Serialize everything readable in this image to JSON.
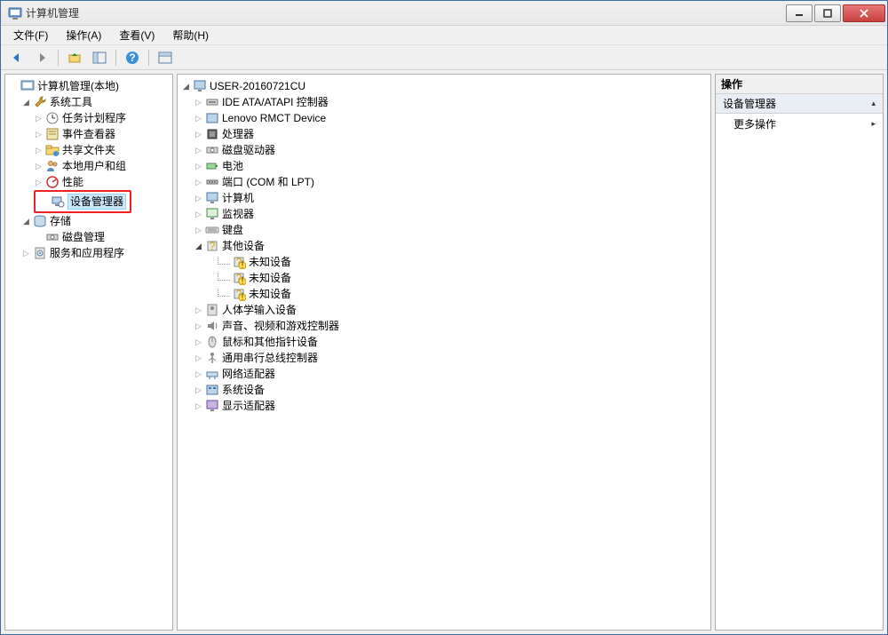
{
  "title": "计算机管理",
  "menus": [
    "文件(F)",
    "操作(A)",
    "查看(V)",
    "帮助(H)"
  ],
  "left_tree": {
    "root": "计算机管理(本地)",
    "groups": [
      {
        "label": "系统工具",
        "expanded": true,
        "children": [
          {
            "label": "任务计划程序",
            "expandable": true
          },
          {
            "label": "事件查看器",
            "expandable": true
          },
          {
            "label": "共享文件夹",
            "expandable": true
          },
          {
            "label": "本地用户和组",
            "expandable": true
          },
          {
            "label": "性能",
            "expandable": true
          },
          {
            "label": "设备管理器",
            "expandable": false,
            "selected": true,
            "red_box": true
          }
        ]
      },
      {
        "label": "存储",
        "expanded": true,
        "children": [
          {
            "label": "磁盘管理",
            "expandable": false
          }
        ]
      },
      {
        "label": "服务和应用程序",
        "expanded": false,
        "children": []
      }
    ]
  },
  "device_tree": {
    "root": "USER-20160721CU",
    "categories": [
      {
        "label": "IDE ATA/ATAPI 控制器",
        "icon": "ide"
      },
      {
        "label": "Lenovo RMCT Device",
        "icon": "device"
      },
      {
        "label": "处理器",
        "icon": "cpu"
      },
      {
        "label": "磁盘驱动器",
        "icon": "disk"
      },
      {
        "label": "电池",
        "icon": "battery"
      },
      {
        "label": "端口 (COM 和 LPT)",
        "icon": "port"
      },
      {
        "label": "计算机",
        "icon": "computer"
      },
      {
        "label": "监视器",
        "icon": "monitor"
      },
      {
        "label": "键盘",
        "icon": "keyboard"
      },
      {
        "label": "其他设备",
        "icon": "other",
        "expanded": true,
        "children": [
          {
            "label": "未知设备",
            "warn": true
          },
          {
            "label": "未知设备",
            "warn": true
          },
          {
            "label": "未知设备",
            "warn": true
          }
        ]
      },
      {
        "label": "人体学输入设备",
        "icon": "hid"
      },
      {
        "label": "声音、视频和游戏控制器",
        "icon": "audio"
      },
      {
        "label": "鼠标和其他指针设备",
        "icon": "mouse"
      },
      {
        "label": "通用串行总线控制器",
        "icon": "usb"
      },
      {
        "label": "网络适配器",
        "icon": "network"
      },
      {
        "label": "系统设备",
        "icon": "system"
      },
      {
        "label": "显示适配器",
        "icon": "display"
      }
    ]
  },
  "actions": {
    "header": "操作",
    "section": "设备管理器",
    "items": [
      "更多操作"
    ]
  }
}
